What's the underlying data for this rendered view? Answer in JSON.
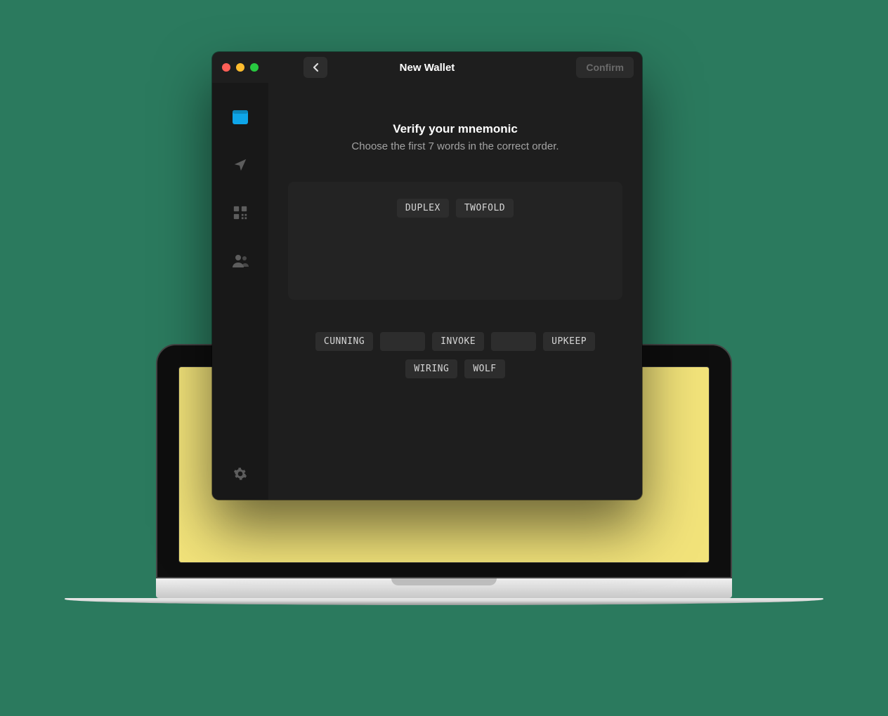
{
  "header": {
    "title": "New Wallet",
    "confirm_label": "Confirm"
  },
  "content": {
    "heading": "Verify your mnemonic",
    "subheading": "Choose the first 7 words in the correct order."
  },
  "selected_words": [
    "DUPLEX",
    "TWOFOLD"
  ],
  "pool_words": [
    {
      "label": "CUNNING",
      "empty": false
    },
    {
      "label": "",
      "empty": true
    },
    {
      "label": "INVOKE",
      "empty": false
    },
    {
      "label": "",
      "empty": true
    },
    {
      "label": "UPKEEP",
      "empty": false
    },
    {
      "label": "WIRING",
      "empty": false
    },
    {
      "label": "WOLF",
      "empty": false
    }
  ],
  "sidebar": {
    "icons": [
      "wallet",
      "send",
      "qr",
      "contacts",
      "settings"
    ]
  },
  "colors": {
    "accent": "#0ea5e9",
    "background_page": "#2b7a5e",
    "laptop_screen": "#f2e37a"
  }
}
